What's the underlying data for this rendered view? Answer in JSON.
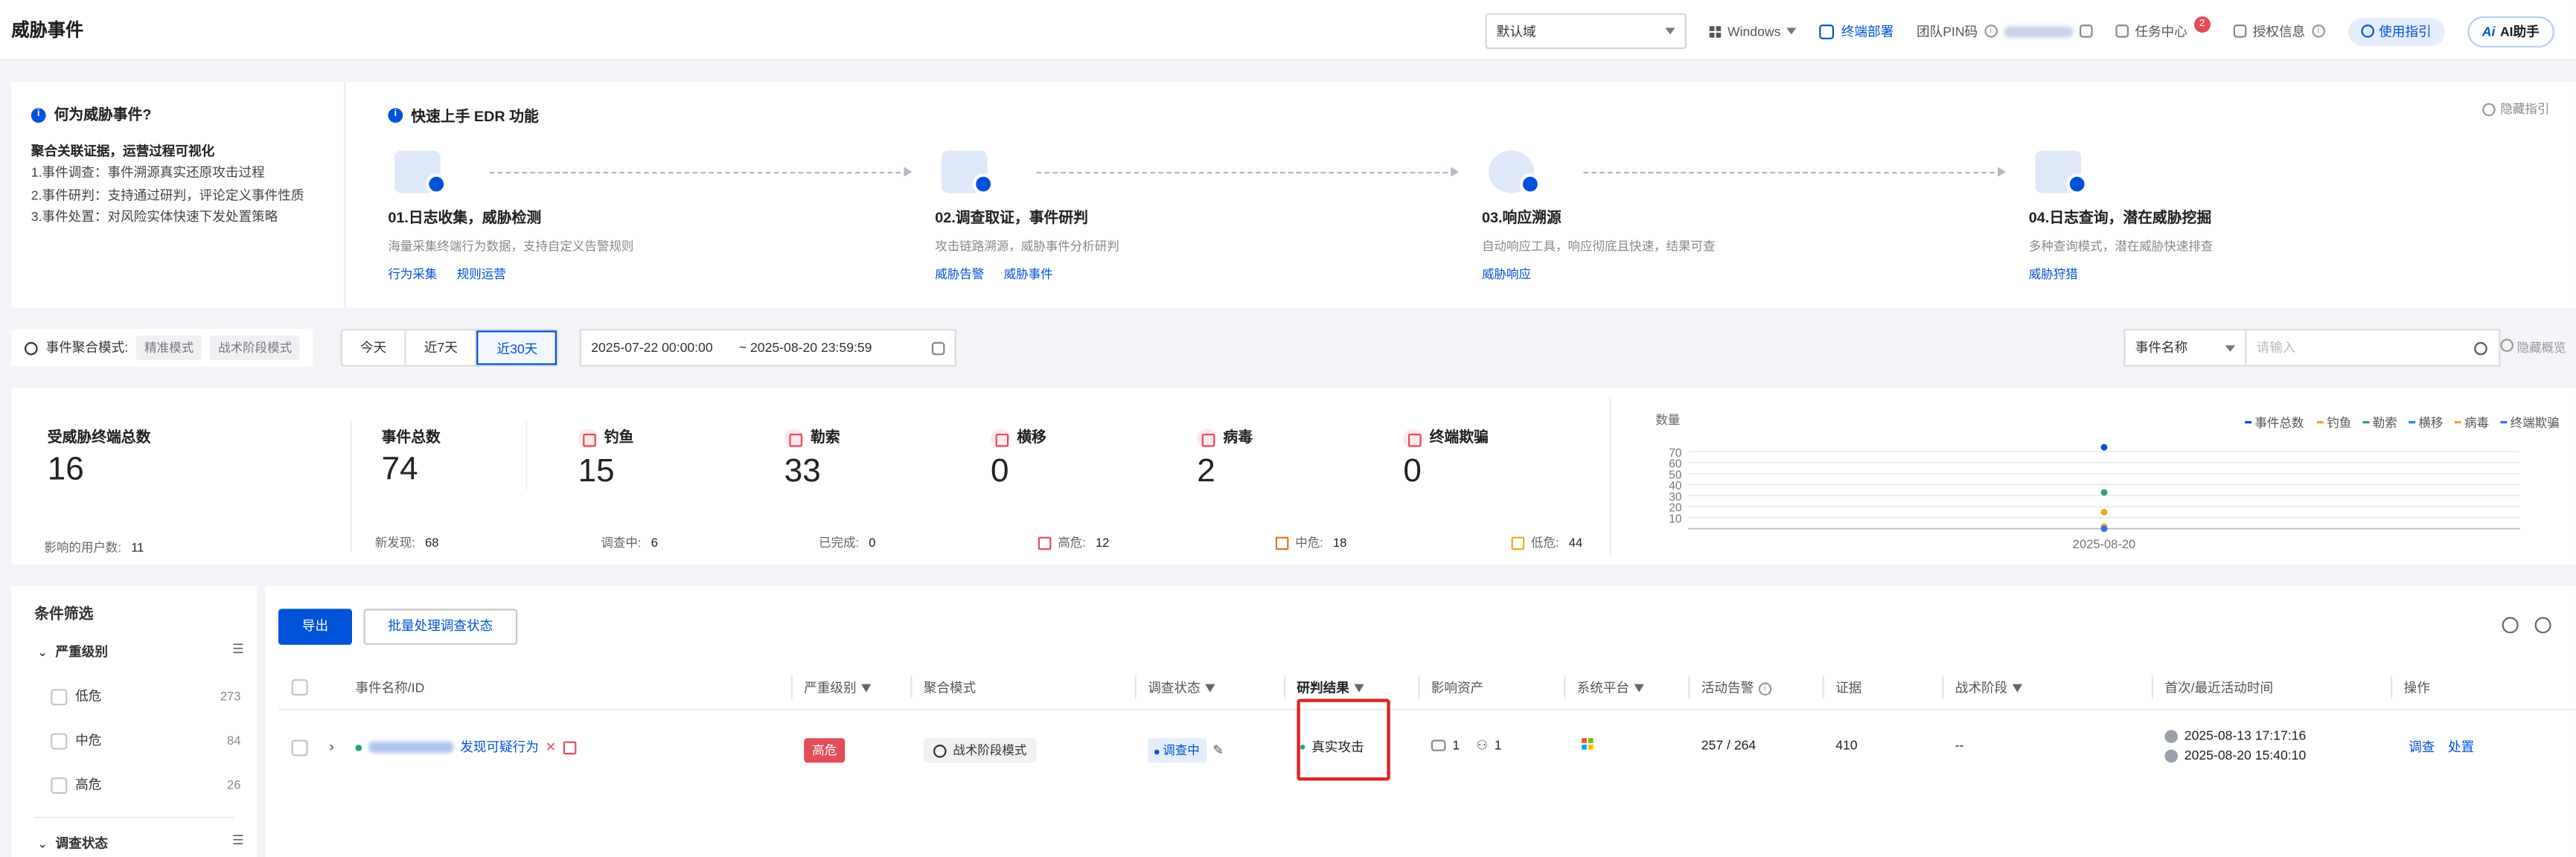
{
  "topbar": {
    "title": "威胁事件",
    "domain_select": "默认域",
    "os": "Windows",
    "deploy": "终端部署",
    "team_pin_label": "团队PIN码",
    "task_center": "任务中心",
    "task_badge": "2",
    "license": "授权信息",
    "guide": "使用指引",
    "ai": "AI助手"
  },
  "intro": {
    "left_title": "何为威胁事件?",
    "left_bold": "聚合关联证据，运营过程可视化",
    "left_lines": [
      "1.事件调查：事件溯源真实还原攻击过程",
      "2.事件研判：支持通过研判，评论定义事件性质",
      "3.事件处置：对风险实体快速下发处置策略"
    ],
    "right_title": "快速上手 EDR 功能",
    "hide_guide": "隐藏指引",
    "steps": [
      {
        "title": "01.日志收集，威胁检测",
        "desc": "海量采集终端行为数据，支持自定义告警规则",
        "links": [
          "行为采集",
          "规则运营"
        ]
      },
      {
        "title": "02.调查取证，事件研判",
        "desc": "攻击链路溯源，威胁事件分析研判",
        "links": [
          "威胁告警",
          "威胁事件"
        ]
      },
      {
        "title": "03.响应溯源",
        "desc": "自动响应工具，响应彻底且快速，结果可查",
        "links": [
          "威胁响应"
        ]
      },
      {
        "title": "04.日志查询，潜在威胁挖掘",
        "desc": "多种查询模式，潜在威胁快速排查",
        "links": [
          "威胁狩猎"
        ]
      }
    ]
  },
  "filter": {
    "mode_label": "事件聚合模式:",
    "mode_a": "精准模式",
    "mode_b": "战术阶段模式",
    "today": "今天",
    "d7": "近7天",
    "d30": "近30天",
    "start": "2025-07-22 00:00:00",
    "end": "~ 2025-08-20 23:59:59",
    "search_field": "事件名称",
    "search_placeholder": "请输入",
    "hide_overview": "隐藏概览"
  },
  "stats": {
    "endpoints_label": "受威胁终端总数",
    "endpoints": "16",
    "users_label": "影响的用户数:",
    "users": "11",
    "events_label": "事件总数",
    "events": "74",
    "new_label": "新发现:",
    "new": "68",
    "investigating_label": "调查中:",
    "investigating": "6",
    "done_label": "已完成:",
    "done": "0",
    "cats": [
      {
        "name": "钓鱼",
        "value": "15"
      },
      {
        "name": "勒索",
        "value": "33"
      },
      {
        "name": "横移",
        "value": "0"
      },
      {
        "name": "病毒",
        "value": "2"
      },
      {
        "name": "终端欺骗",
        "value": "0"
      }
    ],
    "high_label": "高危:",
    "high": "12",
    "mid_label": "中危:",
    "mid": "18",
    "low_label": "低危:",
    "low": "44"
  },
  "chart_data": {
    "type": "scatter",
    "ylabel": "数量",
    "y_ticks": [
      "70",
      "60",
      "50",
      "40",
      "30",
      "20",
      "10"
    ],
    "ylim": [
      0,
      70
    ],
    "categories": [
      "2025-08-20"
    ],
    "series": [
      {
        "name": "事件总数",
        "values": [
          74
        ],
        "color": "#0052d9"
      },
      {
        "name": "钓鱼",
        "values": [
          15
        ],
        "color": "#f5a623"
      },
      {
        "name": "勒索",
        "values": [
          33
        ],
        "color": "#2ba471"
      },
      {
        "name": "横移",
        "values": [
          0
        ],
        "color": "#0594fa"
      },
      {
        "name": "病毒",
        "values": [
          2
        ],
        "color": "#f5a623"
      },
      {
        "name": "终端欺骗",
        "values": [
          0
        ],
        "color": "#366ef4"
      }
    ],
    "legend": "top-right",
    "grid": true
  },
  "side": {
    "title": "条件筛选",
    "group1": "严重级别",
    "options": [
      {
        "label": "低危",
        "count": "273"
      },
      {
        "label": "中危",
        "count": "84"
      },
      {
        "label": "高危",
        "count": "26"
      }
    ],
    "group2": "调查状态"
  },
  "table": {
    "export": "导出",
    "batch": "批量处理调查状态",
    "headers": [
      "事件名称/ID",
      "严重级别",
      "聚合模式",
      "调查状态",
      "研判结果",
      "影响资产",
      "系统平台",
      "活动告警",
      "证据",
      "战术阶段",
      "首次/最近活动时间",
      "操作"
    ],
    "row": {
      "name": "发现可疑行为",
      "severity": "高危",
      "mode": "战术阶段模式",
      "status": "调查中",
      "verdict": "真实攻击",
      "hosts": "1",
      "users": "1",
      "alerts": "257 / 264",
      "evidence": "410",
      "tactic": "--",
      "first_time": "2025-08-13 17:17:16",
      "last_time": "2025-08-20 15:40:10",
      "act1": "调查",
      "act2": "处置"
    }
  }
}
